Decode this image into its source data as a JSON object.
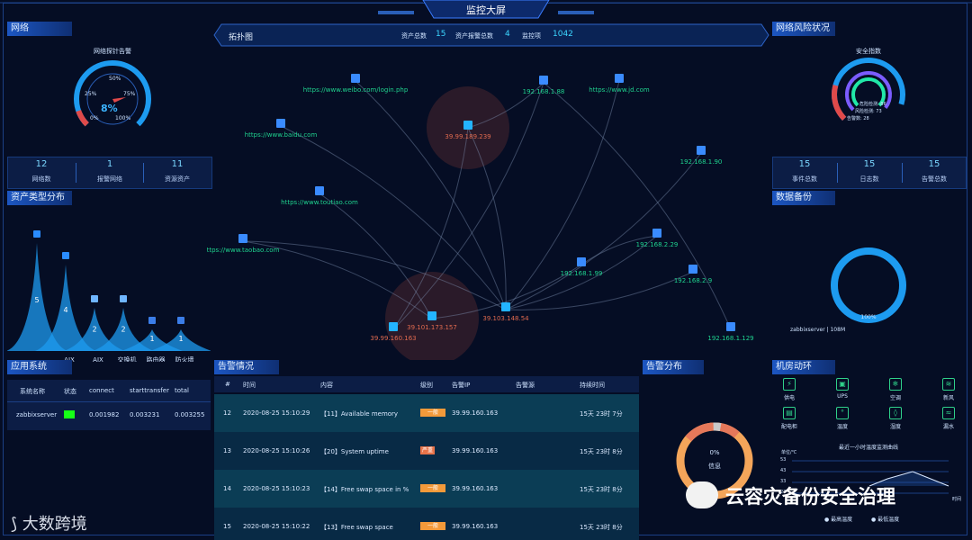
{
  "header": {
    "title": "监控大屏"
  },
  "network": {
    "title": "网络",
    "gauge_title": "网络探针告警",
    "gauge_value": "8%",
    "gauge_ticks": [
      "0%",
      "25%",
      "50%",
      "75%",
      "100%"
    ],
    "stats": [
      {
        "value": "12",
        "label": "网络数"
      },
      {
        "value": "1",
        "label": "报警网络"
      },
      {
        "value": "11",
        "label": "资源资产"
      }
    ]
  },
  "asset_types": {
    "title": "资产类型分布",
    "bars": [
      {
        "value": 5,
        "label": ""
      },
      {
        "value": 4,
        "label": "AIX"
      },
      {
        "value": 2,
        "label": "AIX"
      },
      {
        "value": 2,
        "label": "交换机"
      },
      {
        "value": 1,
        "label": "路由器"
      },
      {
        "value": 1,
        "label": "防火墙"
      }
    ]
  },
  "topology": {
    "title": "拓扑图",
    "metrics": [
      {
        "label": "资产总数",
        "value": "15"
      },
      {
        "label": "资产报警总数",
        "value": "4"
      },
      {
        "label": "监控项",
        "value": "1042"
      }
    ],
    "nodes": [
      {
        "id": "weibo",
        "label": "https://www.weibo.com/login.php",
        "color": "#1fd18e"
      },
      {
        "id": "n188",
        "label": "192.168.1.88",
        "color": "#1fd18e"
      },
      {
        "id": "jd",
        "label": "https://www.jd.com",
        "color": "#1fd18e"
      },
      {
        "id": "baidu",
        "label": "https://www.baidu.com",
        "color": "#1fd18e"
      },
      {
        "id": "n239",
        "label": "39.99.189.239",
        "color": "#e06a4f"
      },
      {
        "id": "n190",
        "label": "192.168.1.90",
        "color": "#1fd18e"
      },
      {
        "id": "toutiao",
        "label": "https://www.toutiao.com",
        "color": "#1fd18e"
      },
      {
        "id": "taobao",
        "label": "ttps://www.taobao.com",
        "color": "#1fd18e"
      },
      {
        "id": "n229",
        "label": "192.168.2.29",
        "color": "#1fd18e"
      },
      {
        "id": "n199",
        "label": "192.168.1.99",
        "color": "#1fd18e"
      },
      {
        "id": "n29",
        "label": "192.168.2.9",
        "color": "#1fd18e"
      },
      {
        "id": "n54",
        "label": "39.103.148.54",
        "color": "#e06a4f"
      },
      {
        "id": "n157",
        "label": "39.101.173.157",
        "color": "#e06a4f"
      },
      {
        "id": "n163",
        "label": "39.99.160.163",
        "color": "#e06a4f"
      },
      {
        "id": "n129",
        "label": "192.168.1.129",
        "color": "#1fd18e"
      }
    ]
  },
  "risk": {
    "title": "网络风险状况",
    "gauge_title": "安全指数",
    "lines": [
      "危险检测: 86",
      "风险检测: 73",
      "告警数: 28"
    ],
    "stats": [
      {
        "value": "15",
        "label": "事件总数"
      },
      {
        "value": "15",
        "label": "日志数"
      },
      {
        "value": "15",
        "label": "告警总数"
      }
    ]
  },
  "backup": {
    "title": "数据备份",
    "ring_value": "100%",
    "ring_label": "zabbixserver | 108M"
  },
  "app_system": {
    "title": "应用系统",
    "columns": [
      "系统名称",
      "状态",
      "connect",
      "starttransfer",
      "total"
    ],
    "rows": [
      {
        "name": "zabbixserver",
        "connect": "0.001982",
        "starttransfer": "0.003231",
        "total": "0.003255"
      }
    ]
  },
  "alerts": {
    "title": "告警情况",
    "columns": [
      "#",
      "时间",
      "内容",
      "级别",
      "告警IP",
      "告警源",
      "持续时间"
    ],
    "rows": [
      {
        "id": "12",
        "time": "2020-08-25 15:10:29",
        "content": "【11】Available memory",
        "level": "一般",
        "ip": "39.99.160.163",
        "duration": "15天 23时 7分"
      },
      {
        "id": "13",
        "time": "2020-08-25 15:10:26",
        "content": "【20】System uptime",
        "level": "严重",
        "ip": "39.99.160.163",
        "duration": "15天 23时 8分"
      },
      {
        "id": "14",
        "time": "2020-08-25 15:10:23",
        "content": "【14】Free swap space in %",
        "level": "一般",
        "ip": "39.99.160.163",
        "duration": "15天 23时 8分"
      },
      {
        "id": "15",
        "time": "2020-08-25 15:10:22",
        "content": "【13】Free swap space",
        "level": "一般",
        "ip": "39.99.160.163",
        "duration": "15天 23时 8分"
      }
    ]
  },
  "alert_dist": {
    "title": "告警分布",
    "center_value": "0%",
    "center_label": "信息"
  },
  "room": {
    "title": "机房动环",
    "items": [
      {
        "label": "供电",
        "icon": "power-icon"
      },
      {
        "label": "UPS",
        "icon": "ups-icon"
      },
      {
        "label": "空调",
        "icon": "ac-icon"
      },
      {
        "label": "新风",
        "icon": "fresh-air-icon"
      },
      {
        "label": "配电柜",
        "icon": "cabinet-icon"
      },
      {
        "label": "温度",
        "icon": "temperature-icon"
      },
      {
        "label": "湿度",
        "icon": "humidity-icon"
      },
      {
        "label": "漏水",
        "icon": "leak-icon"
      }
    ],
    "chart_title": "最近一小时温度监测曲线",
    "chart_unit": "单位/℃",
    "y_ticks": [
      "53",
      "43",
      "33",
      "23"
    ],
    "x_label": "时间",
    "legend": [
      "最高温度",
      "最低温度"
    ]
  },
  "watermarks": {
    "left": "大数跨境",
    "right": "云容灾备份安全治理"
  },
  "colors": {
    "accent": "#1f8fff",
    "alert_red": "#e06a4f",
    "ok_green": "#1fd18e",
    "panel_blue": "#1c56c2"
  }
}
